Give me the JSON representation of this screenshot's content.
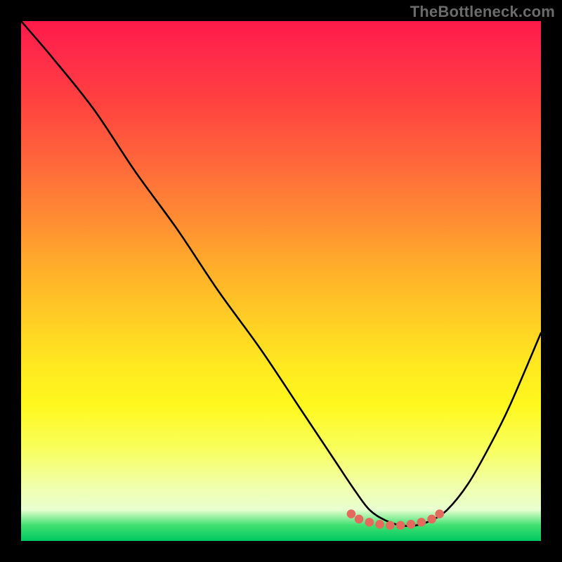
{
  "watermark": "TheBottleneck.com",
  "chart_data": {
    "type": "line",
    "title": "",
    "xlabel": "",
    "ylabel": "",
    "xlim": [
      0,
      100
    ],
    "ylim": [
      0,
      100
    ],
    "grid": false,
    "legend": false,
    "series": [
      {
        "name": "curve",
        "x": [
          0,
          6,
          14,
          22,
          30,
          38,
          46,
          54,
          60,
          64,
          67,
          70,
          73,
          76,
          79,
          82,
          86,
          90,
          94,
          100
        ],
        "values": [
          100,
          93,
          83,
          71,
          60,
          48,
          37,
          25,
          16,
          10,
          6,
          4,
          3,
          3,
          4,
          6,
          11,
          18,
          26,
          40
        ]
      },
      {
        "name": "dots",
        "x": [
          63.5,
          65,
          67,
          69,
          71,
          73,
          75,
          77,
          79,
          80.5
        ],
        "values": [
          5.2,
          4.2,
          3.6,
          3.2,
          3.0,
          3.0,
          3.2,
          3.6,
          4.2,
          5.2
        ]
      }
    ],
    "colors": {
      "curve_stroke": "#000000",
      "dots_fill": "#e46a5e"
    }
  }
}
